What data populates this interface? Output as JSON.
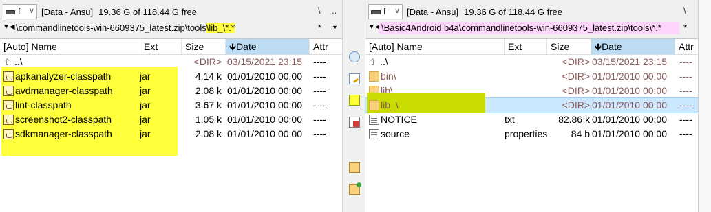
{
  "left": {
    "drive": {
      "letter": "f",
      "label": "[Data - Ansu]",
      "free": "19.36 G of 118.44 G free"
    },
    "top_buttons": [
      "\\",
      ".."
    ],
    "path": {
      "prefix": "\\commandlinetools-win-6609375_latest.zip\\tools",
      "highlight": "\\lib_\\*.*"
    },
    "columns": {
      "name": "[Auto] Name",
      "ext": "Ext",
      "size": "Size",
      "date": "Date",
      "attr": "Attr"
    },
    "rows": [
      {
        "name": "..\\",
        "ext": "",
        "size": "<DIR>",
        "date": "03/15/2021 23:15",
        "attr": "----",
        "icon": "up-icon"
      },
      {
        "name": "apkanalyzer-classpath",
        "ext": "jar",
        "size": "4.14 k",
        "date": "01/01/2010 00:00",
        "attr": "----",
        "icon": "jar-icon"
      },
      {
        "name": "avdmanager-classpath",
        "ext": "jar",
        "size": "2.08 k",
        "date": "01/01/2010 00:00",
        "attr": "----",
        "icon": "jar-icon"
      },
      {
        "name": "lint-classpath",
        "ext": "jar",
        "size": "3.67 k",
        "date": "01/01/2010 00:00",
        "attr": "----",
        "icon": "jar-icon"
      },
      {
        "name": "screenshot2-classpath",
        "ext": "jar",
        "size": "1.05 k",
        "date": "01/01/2010 00:00",
        "attr": "----",
        "icon": "jar-icon"
      },
      {
        "name": "sdkmanager-classpath",
        "ext": "jar",
        "size": "2.08 k",
        "date": "01/01/2010 00:00",
        "attr": "----",
        "icon": "jar-icon"
      }
    ]
  },
  "right": {
    "drive": {
      "letter": "f",
      "label": "[Data - Ansu]",
      "free": "19.36 G of 118.44 G free"
    },
    "top_buttons": [
      "\\",
      ".."
    ],
    "path": "\\Basic4Android b4a\\commandlinetools-win-6609375_latest.zip\\tools\\*.*",
    "columns": {
      "name": "[Auto] Name",
      "ext": "Ext",
      "size": "Size",
      "date": "Date",
      "attr": "Attr"
    },
    "rows": [
      {
        "name": "..\\",
        "ext": "",
        "size": "<DIR>",
        "date": "03/15/2021 23:15",
        "attr": "----",
        "icon": "up-icon"
      },
      {
        "name": "bin\\",
        "ext": "",
        "size": "<DIR>",
        "date": "01/01/2010 00:00",
        "attr": "----",
        "icon": "folder-icon"
      },
      {
        "name": "lib\\",
        "ext": "",
        "size": "<DIR>",
        "date": "01/01/2010 00:00",
        "attr": "----",
        "icon": "folder-icon"
      },
      {
        "name": "lib_\\",
        "ext": "",
        "size": "<DIR>",
        "date": "01/01/2010 00:00",
        "attr": "----",
        "icon": "folder-icon",
        "selected": true
      },
      {
        "name": "NOTICE",
        "ext": "txt",
        "size": "82.86 k",
        "date": "01/01/2010 00:00",
        "attr": "----",
        "icon": "text-file-icon"
      },
      {
        "name": "source",
        "ext": "properties",
        "size": "84 b",
        "date": "01/01/2010 00:00",
        "attr": "----",
        "icon": "text-file-icon"
      }
    ]
  },
  "pathbar_extras": {
    "star": "*",
    "drop": "▼",
    "back_arrow": "◀",
    "dir_arrow": "▼"
  },
  "colors": {
    "highlight_yellow": "#ffff3c",
    "highlight_pink": "#fdd5fb",
    "selection_blue": "#cce8ff",
    "sorted_header": "#bcdcf4"
  }
}
